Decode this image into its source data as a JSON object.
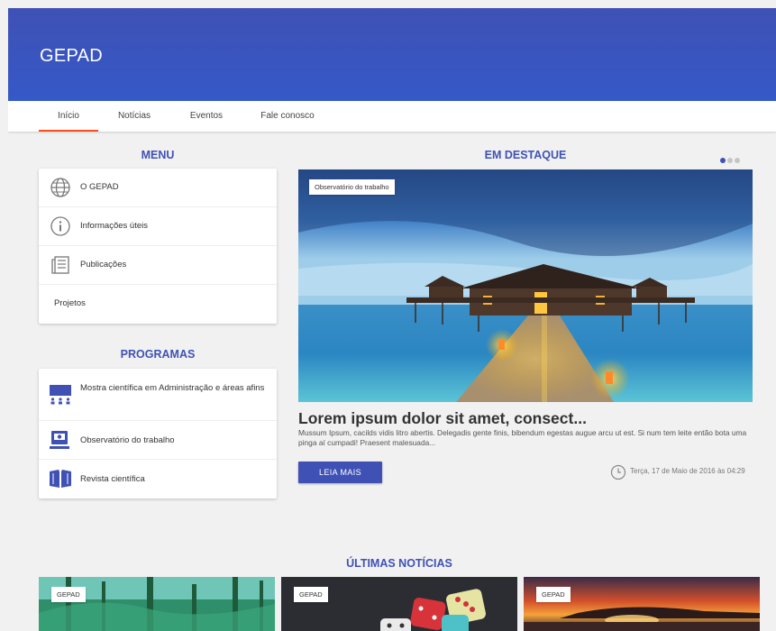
{
  "app": {
    "title": "GEPAD"
  },
  "tabs": [
    {
      "label": "Início",
      "active": true
    },
    {
      "label": "Notícias",
      "active": false
    },
    {
      "label": "Eventos",
      "active": false
    },
    {
      "label": "Fale conosco",
      "active": false
    }
  ],
  "menu": {
    "title": "MENU",
    "items": [
      {
        "label": "O GEPAD",
        "icon": "globe-icon"
      },
      {
        "label": "Informações úteis",
        "icon": "info-icon"
      },
      {
        "label": "Publicações",
        "icon": "newspaper-icon"
      },
      {
        "label": "Projetos",
        "icon": ""
      }
    ]
  },
  "programs": {
    "title": "PROGRAMAS",
    "items": [
      {
        "label": "Mostra científica em Administração e áreas afins",
        "icon": "presentation-icon"
      },
      {
        "label": "Observatório do trabalho",
        "icon": "monitor-icon"
      },
      {
        "label": "Revista científica",
        "icon": "book-icon"
      }
    ]
  },
  "featured": {
    "title": "EM DESTAQUE",
    "badge": "Observatório do trabalho",
    "headline": "Lorem ipsum dolor sit amet, consect...",
    "excerpt": "Mussum Ipsum, cacilds vidis litro abertis. Delegadis gente finis, bibendum egestas augue arcu ut est. Si num tem leite então bota uma pinga aí cumpadi! Praesent malesuada...",
    "button": "LEIA MAIS",
    "date": "Terça, 17 de Maio de 2016 às 04:29",
    "slides": 3,
    "active_slide": 1
  },
  "latest": {
    "title": "ÚLTIMAS NOTÍCIAS",
    "items": [
      {
        "badge": "GEPAD"
      },
      {
        "badge": "GEPAD"
      },
      {
        "badge": "GEPAD"
      }
    ]
  },
  "colors": {
    "primary": "#3f51b5",
    "accent": "#f4511e",
    "background": "#f1f1f1"
  }
}
